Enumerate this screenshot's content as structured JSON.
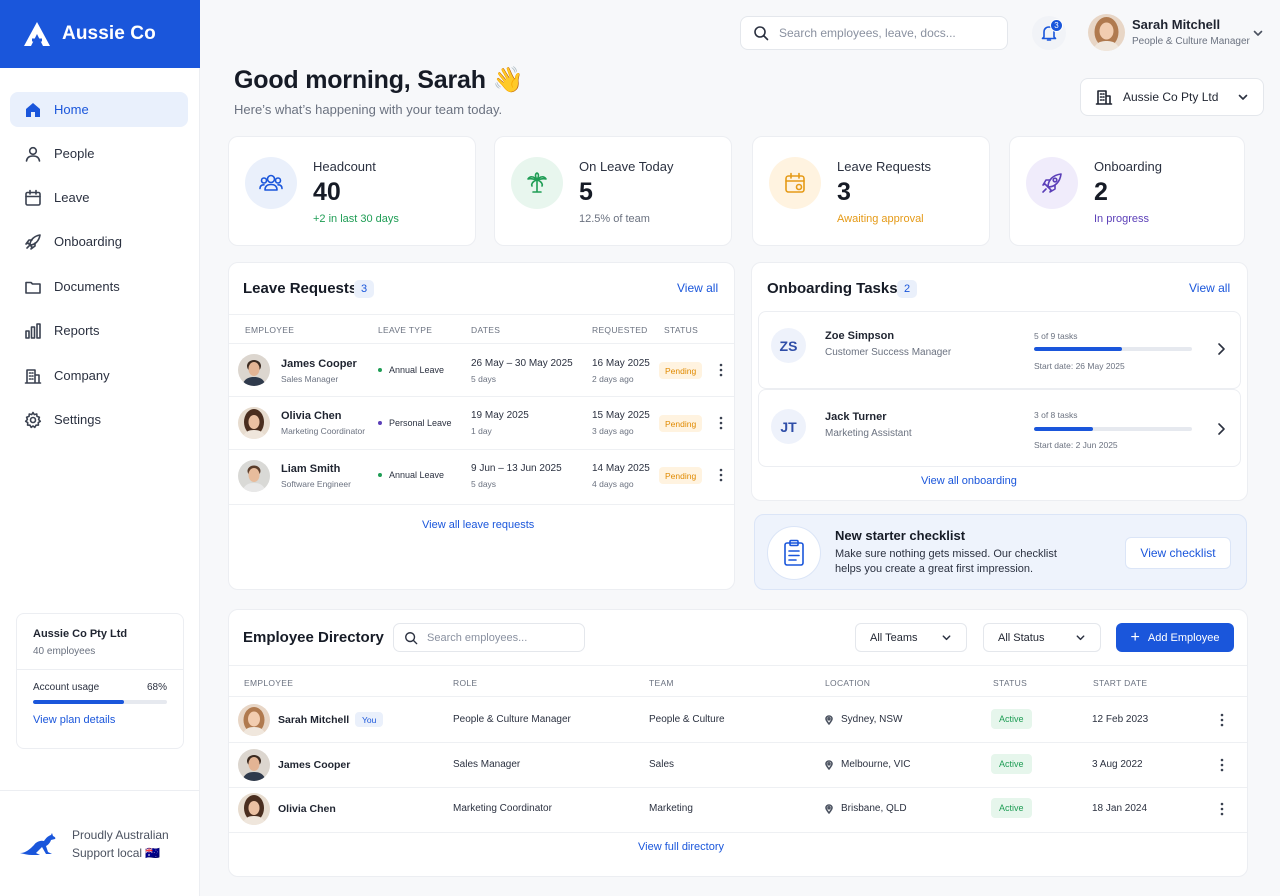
{
  "brand": {
    "name": "Aussie Co"
  },
  "nav": [
    {
      "label": "Home",
      "icon": "home-icon",
      "active": true
    },
    {
      "label": "People",
      "icon": "person-icon"
    },
    {
      "label": "Leave",
      "icon": "calendar-icon"
    },
    {
      "label": "Onboarding",
      "icon": "rocket-icon"
    },
    {
      "label": "Documents",
      "icon": "folder-icon"
    },
    {
      "label": "Reports",
      "icon": "bar-chart-icon"
    },
    {
      "label": "Company",
      "icon": "building-icon"
    },
    {
      "label": "Settings",
      "icon": "gear-icon"
    }
  ],
  "plan": {
    "company": "Aussie Co Pty Ltd",
    "employees": "40 employees",
    "usage_label": "Account usage",
    "usage_pct_text": "68%",
    "usage_fraction": 0.68,
    "link": "View plan details"
  },
  "footer": {
    "line1": "Proudly Australian",
    "line2": "Support local 🇦🇺"
  },
  "header": {
    "search_placeholder": "Search employees, leave, docs...",
    "notifications": "3",
    "user_name": "Sarah Mitchell",
    "user_role": "People & Culture Manager"
  },
  "greeting": {
    "title": "Good morning, Sarah 👋",
    "subtitle": "Here’s what’s happening with your team today."
  },
  "company_select": {
    "value": "Aussie Co Pty Ltd"
  },
  "stats": [
    {
      "label": "Headcount",
      "value": "40",
      "note": "+2 in last 30 days",
      "icon": "people-icon",
      "note_color": "#1f9d55",
      "bg": "#eaf0fb",
      "color": "#1a56db"
    },
    {
      "label": "On Leave Today",
      "value": "5",
      "note": "12.5% of team",
      "icon": "palm-tree-icon",
      "note_color": "#6b7280",
      "bg": "#e8f6ee",
      "color": "#1f9d55"
    },
    {
      "label": "Leave Requests",
      "value": "3",
      "note": "Awaiting approval",
      "icon": "calendar-pending-icon",
      "note_color": "#e59a17",
      "bg": "#fff3e0",
      "color": "#e59a17"
    },
    {
      "label": "Onboarding",
      "value": "2",
      "note": "In progress",
      "icon": "rocket-icon",
      "note_color": "#5b3fb8",
      "bg": "#f0ecfb",
      "color": "#5b3fb8"
    }
  ],
  "leave_requests": {
    "title": "Leave Requests",
    "count": "3",
    "view_all": "View all",
    "columns": [
      "EMPLOYEE",
      "LEAVE TYPE",
      "DATES",
      "REQUESTED",
      "STATUS"
    ],
    "rows": [
      {
        "name": "James Cooper",
        "role": "Sales Manager",
        "type": "Annual Leave",
        "type_color": "#1f9d55",
        "dates": "26 May – 30 May 2025",
        "days": "5 days",
        "requested": "16 May 2025",
        "ago": "2 days ago",
        "status": "Pending"
      },
      {
        "name": "Olivia Chen",
        "role": "Marketing Coordinator",
        "type": "Personal Leave",
        "type_color": "#5b3fb8",
        "dates": "19 May 2025",
        "days": "1 day",
        "requested": "15 May 2025",
        "ago": "3 days ago",
        "status": "Pending"
      },
      {
        "name": "Liam Smith",
        "role": "Software Engineer",
        "type": "Annual Leave",
        "type_color": "#1f9d55",
        "dates": "9 Jun – 13 Jun 2025",
        "days": "5 days",
        "requested": "14 May 2025",
        "ago": "4 days ago",
        "status": "Pending"
      }
    ],
    "footer_link": "View all leave requests"
  },
  "onboarding": {
    "title": "Onboarding Tasks",
    "count": "2",
    "view_all": "View all",
    "items": [
      {
        "initials": "ZS",
        "name": "Zoe Simpson",
        "role": "Customer Success Manager",
        "tasks": "5 of 9 tasks",
        "progress": 0.56,
        "start": "Start date: 26 May 2025"
      },
      {
        "initials": "JT",
        "name": "Jack Turner",
        "role": "Marketing Assistant",
        "tasks": "3 of 8 tasks",
        "progress": 0.375,
        "start": "Start date: 2 Jun 2025"
      }
    ],
    "footer_link": "View all onboarding"
  },
  "checklist": {
    "title": "New starter checklist",
    "description": "Make sure nothing gets missed. Our checklist helps you create a great first impression.",
    "button": "View checklist"
  },
  "directory": {
    "title": "Employee Directory",
    "search_placeholder": "Search employees...",
    "team_filter": "All Teams",
    "status_filter": "All Status",
    "add_button": "Add Employee",
    "columns": [
      "EMPLOYEE",
      "ROLE",
      "TEAM",
      "LOCATION",
      "STATUS",
      "START DATE"
    ],
    "rows": [
      {
        "name": "Sarah Mitchell",
        "you": "You",
        "role": "People & Culture Manager",
        "team": "People & Culture",
        "location": "Sydney, NSW",
        "status": "Active",
        "start": "12 Feb 2023"
      },
      {
        "name": "James Cooper",
        "role": "Sales Manager",
        "team": "Sales",
        "location": "Melbourne, VIC",
        "status": "Active",
        "start": "3 Aug 2022"
      },
      {
        "name": "Olivia Chen",
        "role": "Marketing Coordinator",
        "team": "Marketing",
        "location": "Brisbane, QLD",
        "status": "Active",
        "start": "18 Jan 2024"
      }
    ],
    "footer_link": "View full directory"
  }
}
